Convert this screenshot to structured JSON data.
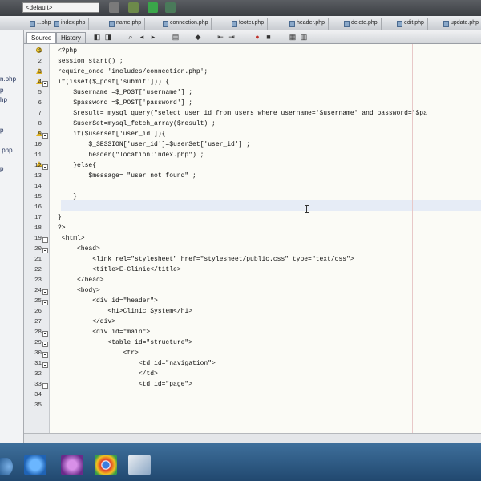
{
  "toolbar": {
    "profile_select": "<default>"
  },
  "file_tabs": [
    {
      "label": "...php"
    },
    {
      "label": "index.php"
    },
    {
      "label": "name.php"
    },
    {
      "label": "connection.php"
    },
    {
      "label": "footer.php"
    },
    {
      "label": "header.php"
    },
    {
      "label": "delete.php"
    },
    {
      "label": "edit.php"
    },
    {
      "label": "update.php"
    }
  ],
  "left_panel": {
    "items": [
      {
        "label": "n.php"
      },
      {
        "label": "p"
      },
      {
        "label": "hp"
      },
      {
        "label": "p"
      },
      {
        "label": ".php"
      },
      {
        "label": "p"
      }
    ]
  },
  "editor_tabs": {
    "source": "Source",
    "history": "History"
  },
  "editor_icons": [
    "back-icon",
    "forward-icon",
    "search-icon",
    "find-prev-icon",
    "find-next-icon",
    "toggle-highlight-icon",
    "bookmark-icon",
    "shift-left-icon",
    "shift-right-icon",
    "record-macro-icon",
    "stop-macro-icon",
    "comment-icon",
    "uncomment-icon"
  ],
  "code": {
    "lines": [
      {
        "num": "1",
        "text": "<?php"
      },
      {
        "num": "2",
        "text": "session_start() ;"
      },
      {
        "num": "3",
        "text": "require_once 'includes/connection.php';"
      },
      {
        "num": "4",
        "text": "if(isset($_post['submit'])) {"
      },
      {
        "num": "5",
        "text": "    $username =$_POST['username'] ;"
      },
      {
        "num": "6",
        "text": "    $password =$_POST['password'] ;"
      },
      {
        "num": "7",
        "text": "    $result= mysql_query(\"select user_id from users where username='$username' and password='$pa"
      },
      {
        "num": "8",
        "text": "    $userSet=mysql_fetch_array($result) ;"
      },
      {
        "num": "9",
        "text": "    if($userset['user_id']){"
      },
      {
        "num": "10",
        "text": "        $_SESSION['user_id']=$userSet['user_id'] ;"
      },
      {
        "num": "11",
        "text": "        header(\"location:index.php\") ;"
      },
      {
        "num": "12",
        "text": "    }else{"
      },
      {
        "num": "13",
        "text": "        $message= \"user not found\" ;"
      },
      {
        "num": "14",
        "text": ""
      },
      {
        "num": "15",
        "text": "    }"
      },
      {
        "num": "16",
        "text": ""
      },
      {
        "num": "17",
        "text": "}"
      },
      {
        "num": "18",
        "text": "?>"
      },
      {
        "num": "19",
        "text": " <html>"
      },
      {
        "num": "20",
        "text": "     <head>"
      },
      {
        "num": "21",
        "text": "         <link rel=\"stylesheet\" href=\"stylesheet/public.css\" type=\"text/css\">"
      },
      {
        "num": "22",
        "text": "         <title>E-Clinic</title>"
      },
      {
        "num": "23",
        "text": "     </head>"
      },
      {
        "num": "24",
        "text": "     <body>"
      },
      {
        "num": "25",
        "text": "         <div id=\"header\">"
      },
      {
        "num": "26",
        "text": "             <h1>Clinic System</h1>"
      },
      {
        "num": "27",
        "text": "         </div>"
      },
      {
        "num": "28",
        "text": "         <div id=\"main\">"
      },
      {
        "num": "29",
        "text": "             <table id=\"structure\">"
      },
      {
        "num": "30",
        "text": "                 <tr>"
      },
      {
        "num": "31",
        "text": "                     <td id=\"navigation\">"
      },
      {
        "num": "32",
        "text": "                     </td>"
      },
      {
        "num": "33",
        "text": "                     <td id=\"page\">"
      },
      {
        "num": "34",
        "text": ""
      },
      {
        "num": "35",
        "text": ""
      }
    ]
  },
  "colors": {
    "editor_bg": "#fbfbf6",
    "current_line": "#e6ecf6",
    "taskbar": "#2f5b86"
  },
  "taskbar": {
    "apps": [
      "ie-icon",
      "media-player-icon",
      "chrome-icon",
      "virtualbox-icon"
    ]
  }
}
